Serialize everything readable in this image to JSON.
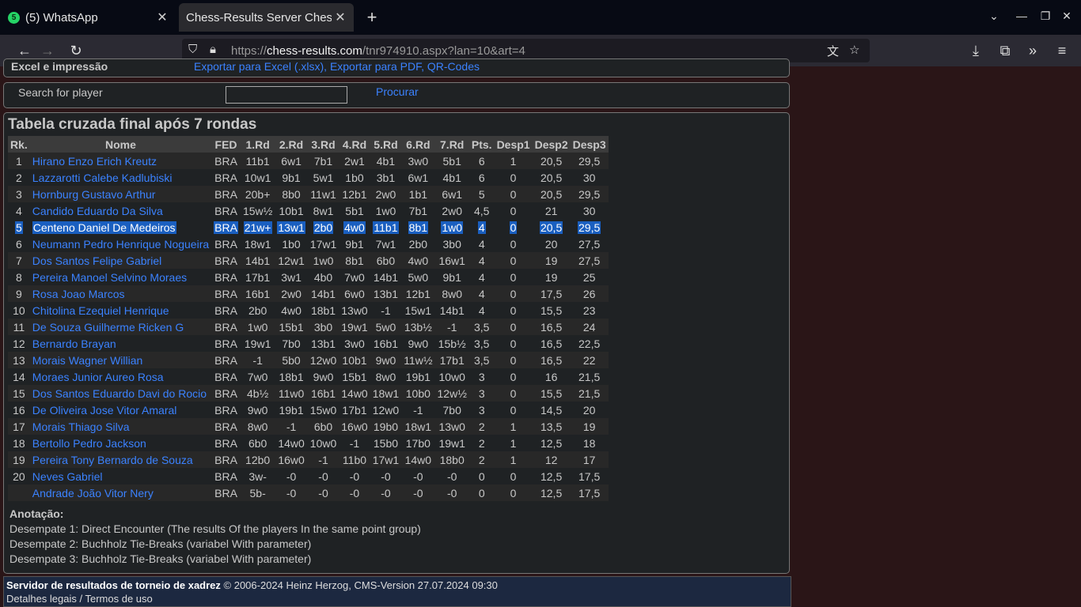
{
  "tabs": [
    {
      "title": "(5) WhatsApp",
      "badge": "5"
    },
    {
      "title": "Chess-Results Server Chess-"
    }
  ],
  "url": {
    "prefix": "https://",
    "domain": "chess-results.com",
    "path": "/tnr974910.aspx?lan=10&art=4"
  },
  "export": {
    "label": "Excel e impressão",
    "links": "Exportar para Excel (.xlsx), Exportar para PDF, QR-Codes"
  },
  "search": {
    "label": "Search for player",
    "value": "",
    "button": "Procurar"
  },
  "table": {
    "title": "Tabela cruzada final após 7 rondas",
    "headers": [
      "Rk.",
      "Nome",
      "FED",
      "1.Rd",
      "2.Rd",
      "3.Rd",
      "4.Rd",
      "5.Rd",
      "6.Rd",
      "7.Rd",
      "Pts.",
      "Desp1",
      "Desp2",
      "Desp3"
    ],
    "highlighted_rank": "5",
    "rows": [
      [
        "1",
        "Hirano Enzo Erich Kreutz",
        "BRA",
        "11b1",
        "6w1",
        "7b1",
        "2w1",
        "4b1",
        "3w0",
        "5b1",
        "6",
        "1",
        "20,5",
        "29,5"
      ],
      [
        "2",
        "Lazzarotti Calebe Kadlubiski",
        "BRA",
        "10w1",
        "9b1",
        "5w1",
        "1b0",
        "3b1",
        "6w1",
        "4b1",
        "6",
        "0",
        "20,5",
        "30"
      ],
      [
        "3",
        "Hornburg Gustavo Arthur",
        "BRA",
        "20b+",
        "8b0",
        "11w1",
        "12b1",
        "2w0",
        "1b1",
        "6w1",
        "5",
        "0",
        "20,5",
        "29,5"
      ],
      [
        "4",
        "Candido Eduardo Da Silva",
        "BRA",
        "15w½",
        "10b1",
        "8w1",
        "5b1",
        "1w0",
        "7b1",
        "2w0",
        "4,5",
        "0",
        "21",
        "30"
      ],
      [
        "5",
        "Centeno Daniel De Medeiros",
        "BRA",
        "21w+",
        "13w1",
        "2b0",
        "4w0",
        "11b1",
        "8b1",
        "1w0",
        "4",
        "0",
        "20,5",
        "29,5"
      ],
      [
        "6",
        "Neumann Pedro Henrique Nogueira",
        "BRA",
        "18w1",
        "1b0",
        "17w1",
        "9b1",
        "7w1",
        "2b0",
        "3b0",
        "4",
        "0",
        "20",
        "27,5"
      ],
      [
        "7",
        "Dos Santos Felipe Gabriel",
        "BRA",
        "14b1",
        "12w1",
        "1w0",
        "8b1",
        "6b0",
        "4w0",
        "16w1",
        "4",
        "0",
        "19",
        "27,5"
      ],
      [
        "8",
        "Pereira Manoel Selvino Moraes",
        "BRA",
        "17b1",
        "3w1",
        "4b0",
        "7w0",
        "14b1",
        "5w0",
        "9b1",
        "4",
        "0",
        "19",
        "25"
      ],
      [
        "9",
        "Rosa Joao Marcos",
        "BRA",
        "16b1",
        "2w0",
        "14b1",
        "6w0",
        "13b1",
        "12b1",
        "8w0",
        "4",
        "0",
        "17,5",
        "26"
      ],
      [
        "10",
        "Chitolina Ezequiel Henrique",
        "BRA",
        "2b0",
        "4w0",
        "18b1",
        "13w0",
        "-1",
        "15w1",
        "14b1",
        "4",
        "0",
        "15,5",
        "23"
      ],
      [
        "11",
        "De Souza Guilherme Ricken G",
        "BRA",
        "1w0",
        "15b1",
        "3b0",
        "19w1",
        "5w0",
        "13b½",
        "-1",
        "3,5",
        "0",
        "16,5",
        "24"
      ],
      [
        "12",
        "Bernardo Brayan",
        "BRA",
        "19w1",
        "7b0",
        "13b1",
        "3w0",
        "16b1",
        "9w0",
        "15b½",
        "3,5",
        "0",
        "16,5",
        "22,5"
      ],
      [
        "13",
        "Morais Wagner Willian",
        "BRA",
        "-1",
        "5b0",
        "12w0",
        "10b1",
        "9w0",
        "11w½",
        "17b1",
        "3,5",
        "0",
        "16,5",
        "22"
      ],
      [
        "14",
        "Moraes Junior Aureo Rosa",
        "BRA",
        "7w0",
        "18b1",
        "9w0",
        "15b1",
        "8w0",
        "19b1",
        "10w0",
        "3",
        "0",
        "16",
        "21,5"
      ],
      [
        "15",
        "Dos Santos Eduardo Davi do Rocio",
        "BRA",
        "4b½",
        "11w0",
        "16b1",
        "14w0",
        "18w1",
        "10b0",
        "12w½",
        "3",
        "0",
        "15,5",
        "21,5"
      ],
      [
        "16",
        "De Oliveira Jose Vitor Amaral",
        "BRA",
        "9w0",
        "19b1",
        "15w0",
        "17b1",
        "12w0",
        "-1",
        "7b0",
        "3",
        "0",
        "14,5",
        "20"
      ],
      [
        "17",
        "Morais Thiago Silva",
        "BRA",
        "8w0",
        "-1",
        "6b0",
        "16w0",
        "19b0",
        "18w1",
        "13w0",
        "2",
        "1",
        "13,5",
        "19"
      ],
      [
        "18",
        "Bertollo Pedro Jackson",
        "BRA",
        "6b0",
        "14w0",
        "10w0",
        "-1",
        "15b0",
        "17b0",
        "19w1",
        "2",
        "1",
        "12,5",
        "18"
      ],
      [
        "19",
        "Pereira Tony Bernardo de Souza",
        "BRA",
        "12b0",
        "16w0",
        "-1",
        "11b0",
        "17w1",
        "14w0",
        "18b0",
        "2",
        "1",
        "12",
        "17"
      ],
      [
        "20",
        "Neves Gabriel",
        "BRA",
        "3w-",
        "-0",
        "-0",
        "-0",
        "-0",
        "-0",
        "-0",
        "0",
        "0",
        "12,5",
        "17,5"
      ],
      [
        "",
        "Andrade João Vitor Nery",
        "BRA",
        "5b-",
        "-0",
        "-0",
        "-0",
        "-0",
        "-0",
        "-0",
        "0",
        "0",
        "12,5",
        "17,5"
      ]
    ]
  },
  "notes": {
    "title": "Anotação:",
    "lines": [
      "Desempate 1: Direct Encounter (The results Of the players In the same point group)",
      "Desempate 2: Buchholz Tie-Breaks (variabel With parameter)",
      "Desempate 3: Buchholz Tie-Breaks (variabel With parameter)"
    ]
  },
  "footer": {
    "server": "Servidor de resultados de torneio de xadrez",
    "copyright": " © 2006-2024 Heinz Herzog, CMS-Version 27.07.2024 09:30",
    "legal": "Detalhes legais / Termos de uso"
  }
}
